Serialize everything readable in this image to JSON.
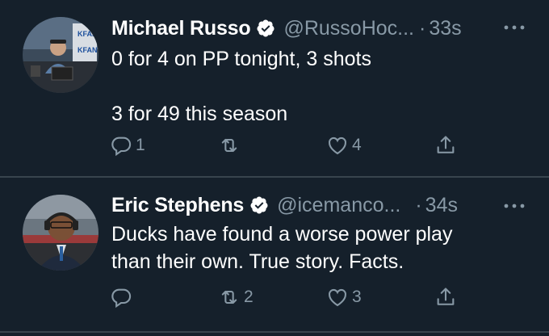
{
  "tweets": [
    {
      "name": "Michael Russo",
      "handle": "@RussoHoc...",
      "dot": "·",
      "time": "33s",
      "text_lines": [
        "0 for 4 on PP tonight, 3 shots",
        "",
        "3 for 49 this season"
      ],
      "reply_count": "1",
      "retweet_count": "",
      "like_count": "4",
      "avatar_sign_text": "KFAN"
    },
    {
      "name": "Eric Stephens",
      "handle": "@icemanco...",
      "dot": "·",
      "time": "34s",
      "text_lines": [
        "Ducks have found a worse power play",
        "than their own. True story. Facts."
      ],
      "reply_count": "",
      "retweet_count": "2",
      "like_count": "3"
    }
  ],
  "colors": {
    "background": "#15202b",
    "secondary_text": "#8899a6",
    "divider": "#38444d"
  },
  "icons": [
    "verified-badge-icon",
    "more-icon",
    "reply-icon",
    "retweet-icon",
    "like-icon",
    "share-icon"
  ]
}
